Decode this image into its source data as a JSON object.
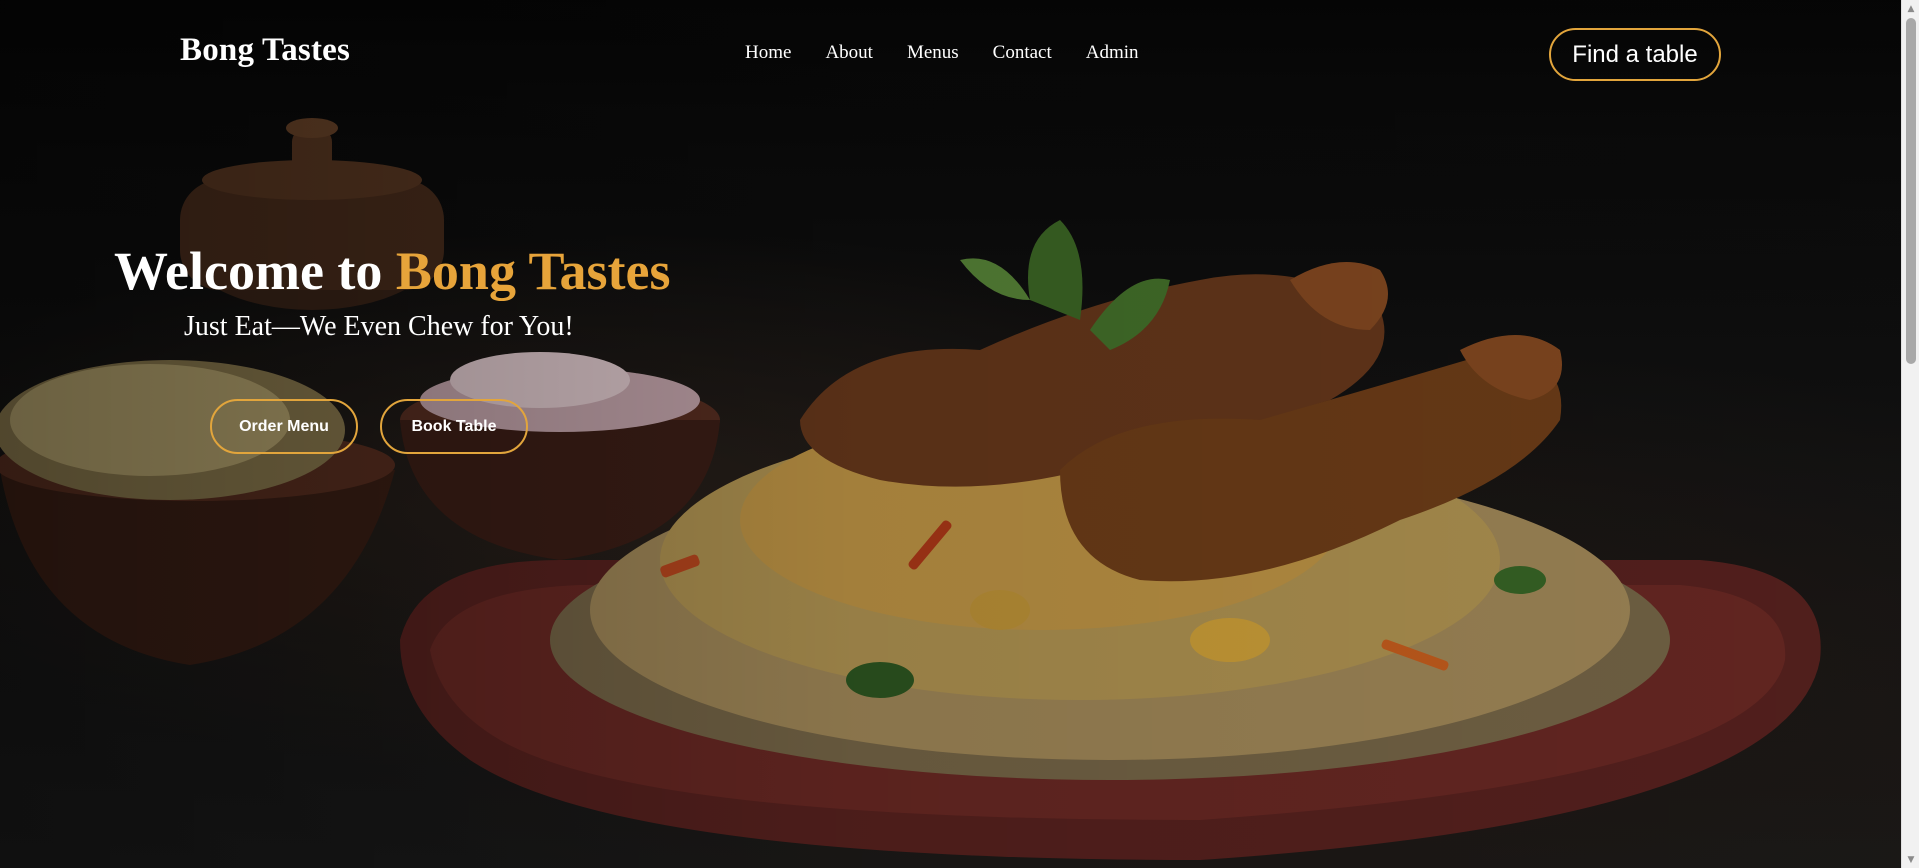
{
  "brand": {
    "name": "Bong Tastes"
  },
  "nav": {
    "items": [
      {
        "label": "Home"
      },
      {
        "label": "About"
      },
      {
        "label": "Menus"
      },
      {
        "label": "Contact"
      },
      {
        "label": "Admin"
      }
    ]
  },
  "header": {
    "cta_label": "Find a table"
  },
  "hero": {
    "title_prefix": "Welcome to ",
    "title_accent": "Bong Tastes",
    "subtitle": "Just Eat—We Even Chew for You!",
    "buttons": {
      "order_label": "Order Menu",
      "book_label": "Book Table"
    }
  },
  "colors": {
    "accent": "#e7a43a",
    "button_border": "#e2a53c",
    "text": "#ffffff",
    "background": "#0b0b0b"
  },
  "icons": {
    "scroll_up": "triangle-up-icon",
    "scroll_down": "triangle-down-icon"
  }
}
